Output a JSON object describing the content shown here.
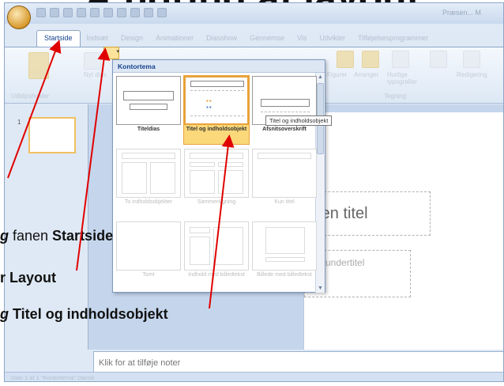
{
  "slide_title": "Ændring af layout",
  "window": {
    "title": "Præsen... M",
    "tabs": [
      "Startside",
      "Indsæt",
      "Design",
      "Animationer",
      "Diasshow",
      "Gennemse",
      "Vis",
      "Udvikler",
      "Tilføjelsesprogrammer"
    ],
    "active_tab": "Startside"
  },
  "ribbon": {
    "group_clipboard": "Udklipsholder",
    "new_slide": "Nyt dias",
    "group_drawing": "Tegning",
    "figures": "Figurer",
    "arrange": "Arranger",
    "quick_styles": "Hurtige typografier",
    "editing": "Redigering"
  },
  "gallery": {
    "header": "Kontortema",
    "layouts": [
      {
        "label": "Titeldias",
        "state": "normal"
      },
      {
        "label": "Titel og indholdsobjekt",
        "state": "selected"
      },
      {
        "label": "Afsnitsoverskrift",
        "state": "normal"
      },
      {
        "label": "To indholdsobjekter",
        "state": "faded"
      },
      {
        "label": "Sammenligning",
        "state": "faded"
      },
      {
        "label": "Kun titel",
        "state": "faded"
      },
      {
        "label": "Tomt",
        "state": "faded"
      },
      {
        "label": "Indhold med billedtekst",
        "state": "faded"
      },
      {
        "label": "Billede med billedtekst",
        "state": "faded"
      }
    ],
    "tooltip": "Titel og indholdsobjekt"
  },
  "slide": {
    "title_placeholder": "e en titel",
    "subtitle_placeholder": "undertitel"
  },
  "notes_placeholder": "Klik for at tilføje noter",
  "statusbar": "Dias 1 af 1   \"Kontortema\"   Dansk",
  "instructions": [
    {
      "prefix": "g",
      "text": " fanen ",
      "target": "Startside"
    },
    {
      "prefix": "",
      "text": "r ",
      "target": "Layout"
    },
    {
      "prefix": "g",
      "text": " ",
      "target": "Titel og indholdsobjekt"
    }
  ],
  "colors": {
    "arrow": "#e00000",
    "selection": "#fbd87a",
    "accent": "#15428b"
  }
}
